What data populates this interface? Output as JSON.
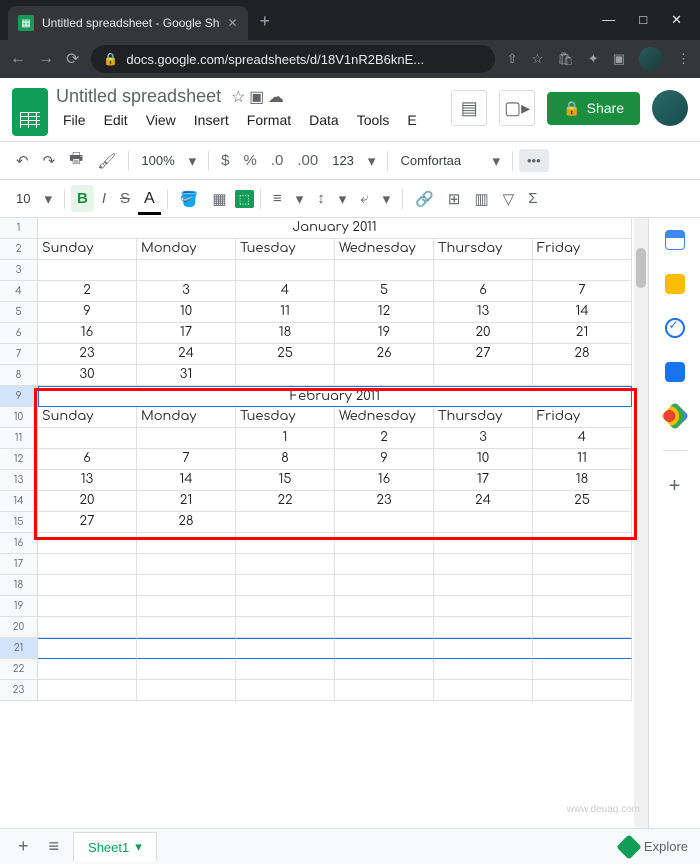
{
  "browser": {
    "tab_title": "Untitled spreadsheet - Google Sh",
    "url": "docs.google.com/spreadsheets/d/18V1nR2B6knE..."
  },
  "doc": {
    "title": "Untitled spreadsheet",
    "menus": [
      "File",
      "Edit",
      "View",
      "Insert",
      "Format",
      "Data",
      "Tools",
      "E"
    ]
  },
  "toolbar": {
    "zoom": "100%",
    "font": "Comfortaa",
    "font_size": "10",
    "number_fmt": "123"
  },
  "share": {
    "label": "Share"
  },
  "sheet": {
    "active_tab": "Sheet1",
    "months": [
      {
        "title": "January 2011",
        "days": [
          "Sunday",
          "Monday",
          "Tuesday",
          "Wednesday",
          "Thursday",
          "Friday"
        ],
        "rows": [
          [
            "",
            "",
            "",
            "",
            "",
            ""
          ],
          [
            "2",
            "3",
            "4",
            "5",
            "6",
            "7"
          ],
          [
            "9",
            "10",
            "11",
            "12",
            "13",
            "14"
          ],
          [
            "16",
            "17",
            "18",
            "19",
            "20",
            "21"
          ],
          [
            "23",
            "24",
            "25",
            "26",
            "27",
            "28"
          ],
          [
            "30",
            "31",
            "",
            "",
            "",
            ""
          ]
        ]
      },
      {
        "title": "February 2011",
        "days": [
          "Sunday",
          "Monday",
          "Tuesday",
          "Wednesday",
          "Thursday",
          "Friday"
        ],
        "rows": [
          [
            "",
            "",
            "1",
            "2",
            "3",
            "4"
          ],
          [
            "6",
            "7",
            "8",
            "9",
            "10",
            "11"
          ],
          [
            "13",
            "14",
            "15",
            "16",
            "17",
            "18"
          ],
          [
            "20",
            "21",
            "22",
            "23",
            "24",
            "25"
          ],
          [
            "27",
            "28",
            "",
            "",
            "",
            ""
          ]
        ]
      }
    ]
  },
  "explore": {
    "label": "Explore"
  },
  "watermark": "www.deuaq.com"
}
